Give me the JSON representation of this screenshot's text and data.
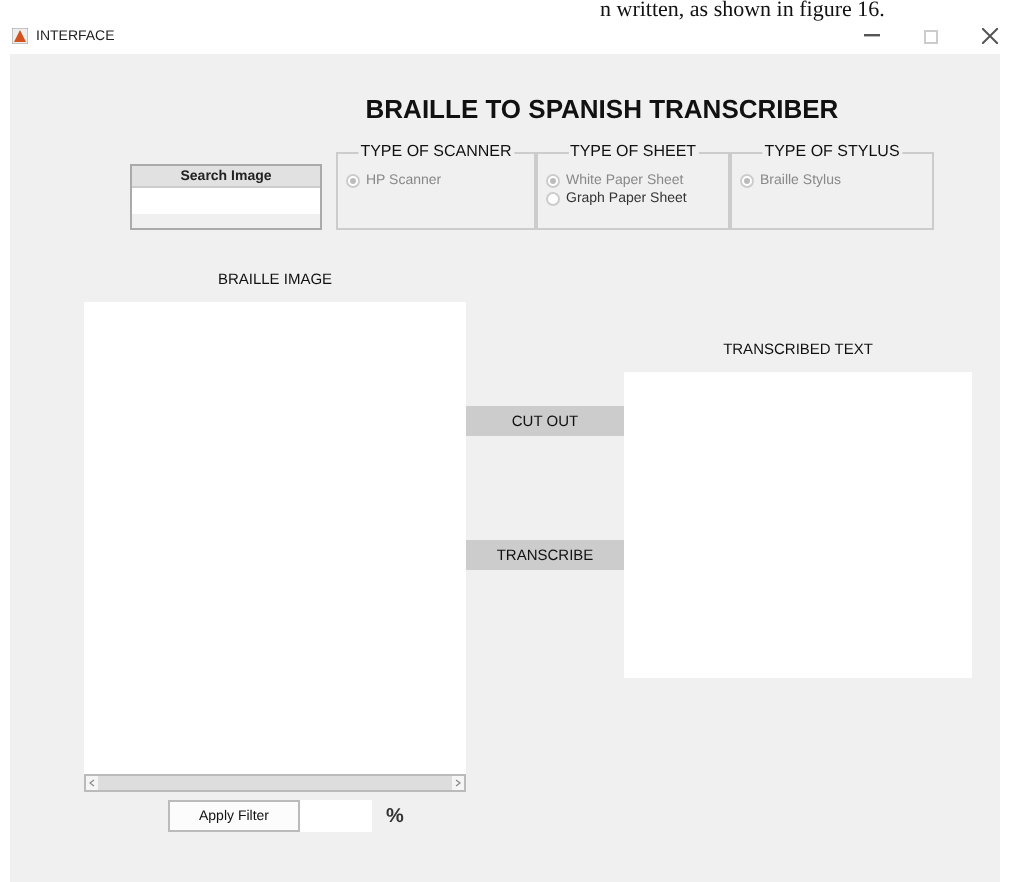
{
  "document_text": "n written, as shown in figure 16.",
  "window": {
    "title": "INTERFACE"
  },
  "heading": "BRAILLE TO SPANISH TRANSCRIBER",
  "search": {
    "button": "Search Image"
  },
  "option_groups": [
    {
      "title": "TYPE OF SCANNER",
      "options": [
        {
          "label": "HP Scanner",
          "selected": true,
          "disabled": true
        }
      ]
    },
    {
      "title": "TYPE OF SHEET",
      "options": [
        {
          "label": "White Paper Sheet",
          "selected": true,
          "disabled": true
        },
        {
          "label": "Graph Paper Sheet",
          "selected": false,
          "disabled": false
        }
      ]
    },
    {
      "title": "TYPE OF STYLUS",
      "options": [
        {
          "label": "Braille Stylus",
          "selected": true,
          "disabled": true
        }
      ]
    }
  ],
  "image_panel": {
    "label": "BRAILLE IMAGE"
  },
  "filter": {
    "button": "Apply Filter",
    "unit": "%"
  },
  "actions": [
    "CUT OUT",
    "TRANSCRIBE"
  ],
  "text_panel": {
    "label": "TRANSCRIBED TEXT"
  }
}
